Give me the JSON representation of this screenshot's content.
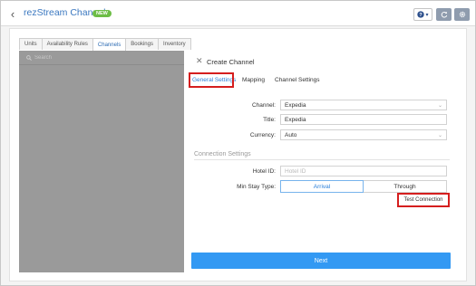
{
  "header": {
    "title": "rezStream Channels",
    "badge": "NEW",
    "back_icon": "chevron-left-icon",
    "help_icon": "question-circle-icon",
    "help_caret": "▾",
    "refresh_icon": "refresh-icon",
    "settings_icon": "gear-icon"
  },
  "tabs": [
    {
      "label": "Units",
      "active": false
    },
    {
      "label": "Availability Rules",
      "active": false
    },
    {
      "label": "Channels",
      "active": true
    },
    {
      "label": "Bookings",
      "active": false
    },
    {
      "label": "Inventory",
      "active": false
    }
  ],
  "list": {
    "search_placeholder": "Search"
  },
  "dialog": {
    "title": "Create Channel",
    "tabs": [
      {
        "label": "General Settings",
        "active": true
      },
      {
        "label": "Mapping",
        "active": false
      },
      {
        "label": "Channel Settings",
        "active": false
      }
    ],
    "fields": {
      "channel": {
        "label": "Channel:",
        "value": "Expedia"
      },
      "title": {
        "label": "Title:",
        "value": "Expedia"
      },
      "currency": {
        "label": "Currency:",
        "value": "Auto"
      }
    },
    "connection": {
      "section_title": "Connection Settings",
      "hotel_id": {
        "label": "Hotel ID:",
        "placeholder": "Hotel ID"
      },
      "min_stay": {
        "label": "Min Stay Type:",
        "options": [
          "Arrival",
          "Through"
        ],
        "selected": "Arrival"
      },
      "test_button": "Test Connection"
    },
    "next_button": "Next"
  },
  "colors": {
    "accent": "#2a7fd9",
    "primary_button": "#3399f3",
    "highlight_box": "#d51e1e",
    "badge": "#6cbd45",
    "list_pane": "#9a9a9a"
  }
}
